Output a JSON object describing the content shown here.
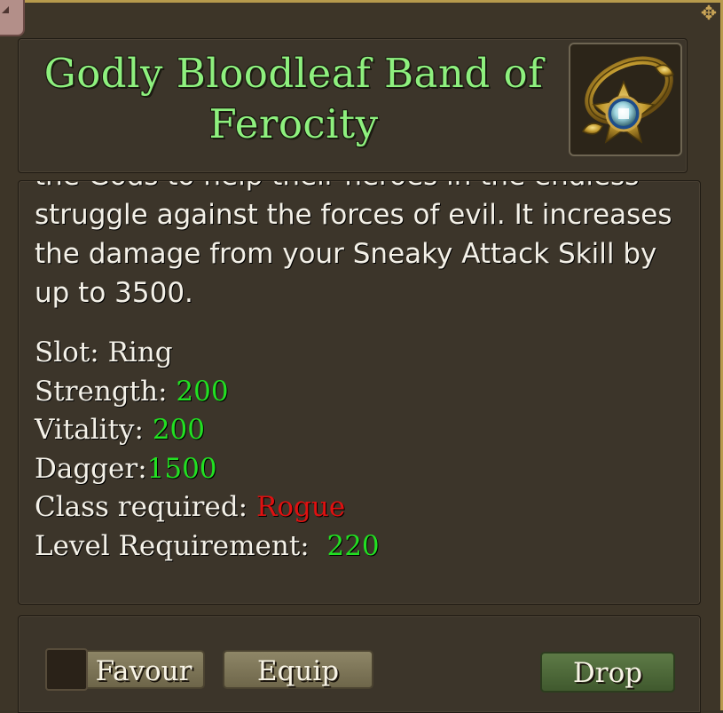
{
  "item": {
    "name": "Godly Bloodleaf Band of Ferocity",
    "icon": "golden-ring-icon"
  },
  "description": {
    "text": "the Gods to help their heroes in the endless struggle against the forces of evil. It increases the damage from your Sneaky Attack Skill by up to 3500."
  },
  "stats": {
    "slot_label": "Slot:",
    "slot_value": "Ring",
    "strength_label": "Strength:",
    "strength_value": "200",
    "vitality_label": "Vitality:",
    "vitality_value": "200",
    "dagger_label": "Dagger:",
    "dagger_value": "1500",
    "class_label": "Class required:",
    "class_value": "Rogue",
    "level_label": "Level Requirement:",
    "level_value": "220"
  },
  "buttons": {
    "favour": "Favour",
    "equip": "Equip",
    "drop": "Drop"
  },
  "colors": {
    "title": "#8ef07e",
    "stat_value": "#22e022",
    "class_value": "#e01010",
    "drop_button": "#4f6a3a"
  }
}
